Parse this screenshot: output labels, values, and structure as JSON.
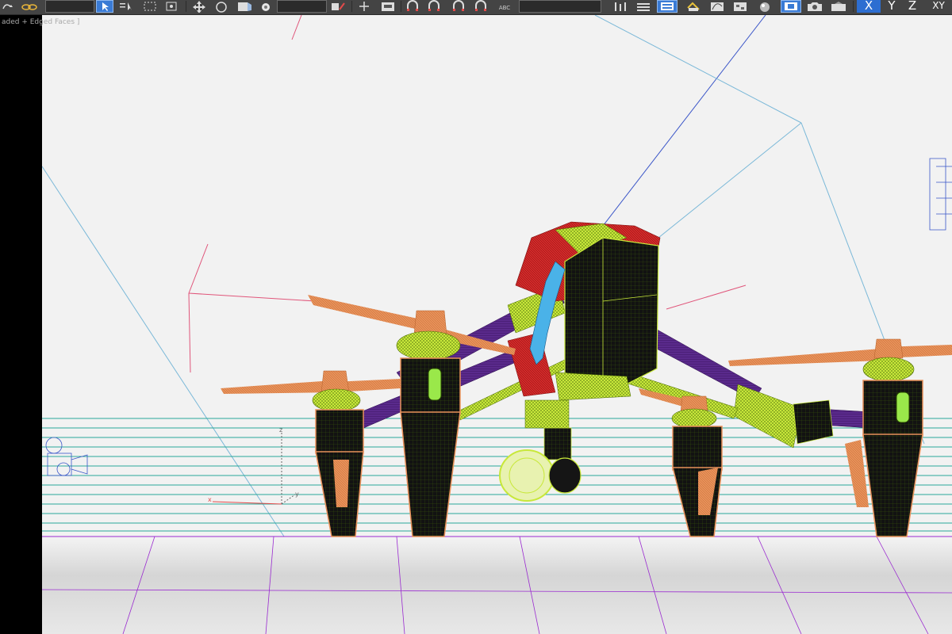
{
  "viewport": {
    "shading_label": "aded + Edged Faces ]",
    "axis_labels": {
      "x": "x",
      "y": "y",
      "z": "z"
    }
  },
  "toolbar": {
    "snap_label": "ABC",
    "axis_buttons": {
      "x": "X",
      "y": "Y",
      "z": "Z",
      "xy": "XY"
    }
  },
  "icons": [
    "undo-redo-icon",
    "link-icon",
    "select-object-icon",
    "select-by-name-icon",
    "rectangular-selection-icon",
    "window-crossing-icon",
    "move-icon",
    "rotate-icon",
    "scale-icon",
    "pivot-icon",
    "manipulate-icon",
    "snap-icon",
    "angle-snap-icon",
    "percent-snap-icon",
    "spinner-snap-icon",
    "mirror-icon",
    "align-icon",
    "layer-icon",
    "scene-explorer-icon",
    "curve-editor-icon",
    "schematic-view-icon",
    "material-editor-icon",
    "render-setup-icon",
    "render-icon"
  ],
  "colors": {
    "toolbar_bg": "#444444",
    "active_blue": "#3a7bd5",
    "viewport_bg": "#f2f2f2",
    "drone_wire": "#c8e83a",
    "drone_body": "#111111",
    "prop_orange": "#e8915a",
    "frame_purple": "#5a2a8c",
    "canopy_red": "#d42a2a",
    "gimbal_cable": "#4ab2e8",
    "grid_teal": "#2aa89a",
    "ground_purple": "#9a2ad0"
  }
}
